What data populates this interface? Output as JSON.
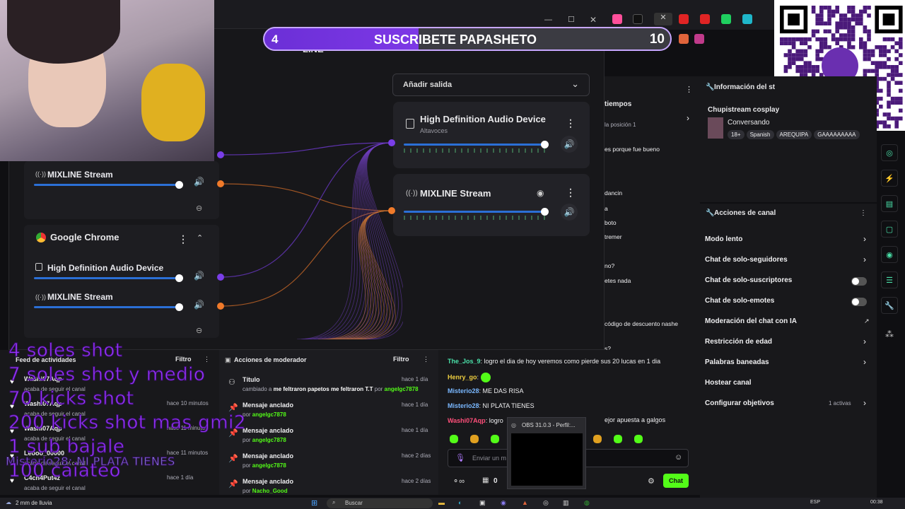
{
  "banner": {
    "left_num": "4",
    "text": "SUSCRIBETE PAPASHETO",
    "right_num": "10",
    "progress": 0.38
  },
  "mixline": {
    "app_title": "LINE",
    "add_output": "Añadir salida",
    "out1": {
      "title": "High Definition Audio Device",
      "subtitle": "Altavoces",
      "level": 1.0
    },
    "out2": {
      "title": "MIXLINE Stream",
      "level": 1.0
    },
    "src_top": {
      "row_label": "MIXLINE Stream"
    },
    "chrome": {
      "title": "Google Chrome",
      "row1": "High Definition Audio Device",
      "row2": "MIXLINE Stream"
    }
  },
  "twitch": {
    "header": "tiempos",
    "sub": "la posición 1",
    "msgs": [
      "es porque fue bueno",
      "dancin",
      "a",
      "boto",
      "tremer",
      "no?",
      "etes nada",
      "código de descuento nashe",
      "s?"
    ]
  },
  "stream_info": {
    "title": "Información del st",
    "channel": "Chupistream cosplay",
    "category": "Conversando",
    "tags": [
      "18+",
      "Spanish",
      "AREQUIPA",
      "GAAAAAAAAA"
    ]
  },
  "channel_actions": {
    "title": "Acciones de canal",
    "items": [
      {
        "label": "Modo lento",
        "kind": "chev"
      },
      {
        "label": "Chat de solo-seguidores",
        "kind": "chev"
      },
      {
        "label": "Chat de solo-suscriptores",
        "kind": "toggle"
      },
      {
        "label": "Chat de solo-emotes",
        "kind": "toggle"
      },
      {
        "label": "Moderación del chat con IA",
        "kind": "ext"
      },
      {
        "label": "Restricción de edad",
        "kind": "chev"
      },
      {
        "label": "Palabras baneadas",
        "kind": "chev"
      },
      {
        "label": "Hostear canal",
        "kind": "none"
      },
      {
        "label": "Configurar objetivos",
        "kind": "goal",
        "extra": "1 activas"
      }
    ]
  },
  "feed": {
    "title": "Feed de actividades",
    "filter": "Filtro",
    "items": [
      {
        "name": "Washi07Aqp",
        "sub": "acaba de seguir el canal",
        "time": ""
      },
      {
        "name": "Washi07Aqp",
        "sub": "acaba de seguir el canal",
        "time": "hace 10 minutos"
      },
      {
        "name": "Washi07Aqp",
        "sub": "acaba de seguir el canal",
        "time": "hace 11 minutos"
      },
      {
        "name": "Leooo_00000",
        "sub": "acaba de seguir el canal",
        "time": "hace 11 minutos"
      },
      {
        "name": "C4ch4Put4z",
        "sub": "acaba de seguir el canal",
        "time": "hace 1 día"
      }
    ]
  },
  "overlay_lines": [
    "4 soles  shot",
    "7 soles  shot  y medio",
    "70 kicks  shot",
    "200 kicks  shot mas gmi2",
    "1 sub  bajale",
    "Misterio28: NI PLATA TIENES",
    "100 caiateo"
  ],
  "mod_actions": {
    "title": "Acciones de moderador",
    "filter": "Filtro",
    "items": [
      {
        "title": "Título",
        "sub_pre": "cambiado a ",
        "sub_strong": "me feltraron papetos me feltraron T.T",
        "by": "angelgc7878",
        "time": "hace 1 día"
      },
      {
        "title": "Mensaje anclado",
        "sub_pre": "por ",
        "by": "angelgc7878",
        "time": "hace 1 día"
      },
      {
        "title": "Mensaje anclado",
        "sub_pre": "por ",
        "by": "angelgc7878",
        "time": "hace 1 día"
      },
      {
        "title": "Mensaje anclado",
        "sub_pre": "por ",
        "by": "angelgc7878",
        "time": "hace 2 días"
      },
      {
        "title": "Mensaje anclado",
        "sub_pre": "por ",
        "by": "Nacho_Good",
        "time": "hace 2 días"
      }
    ]
  },
  "chat": {
    "messages": [
      {
        "user": "The_Jos_9",
        "color": "#4ae0a8",
        "text": "logro el dia de hoy veremos como pierde sus 20 lucas en 1 dia"
      },
      {
        "user": "Henry_go",
        "color": "#f0d040",
        "text": ""
      },
      {
        "user": "Misterio28",
        "color": "#7ab8ff",
        "text": "ME DAS RISA"
      },
      {
        "user": "Misterio28",
        "color": "#7ab8ff",
        "text": "NI PLATA TIENES"
      },
      {
        "user": "Washi07Aqp",
        "color": "#ff4f7a",
        "text": "logro"
      }
    ],
    "tail": "ejor apuesta a galgos",
    "placeholder": "Enviar un m",
    "send": "Chat",
    "points": "0",
    "obs_popup": "OBS 31.0.3 - Perfil:..."
  },
  "taskbar": {
    "weather": "2 mm de lluvia",
    "search": "Buscar",
    "lang": "ESP",
    "time": "00:38"
  },
  "colors": {
    "purple": "#7a3ee8",
    "orange": "#f07a2a",
    "accent": "#2b6fd6"
  }
}
